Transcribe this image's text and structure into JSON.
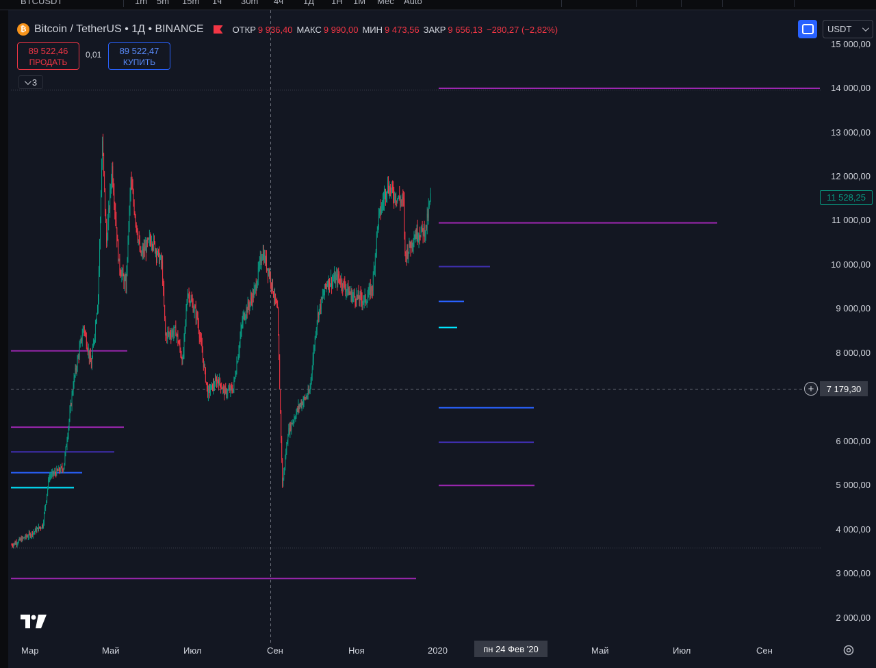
{
  "topbar": {
    "items": [
      "BTCUSDT",
      "1m",
      "5m",
      "15m",
      "1ч",
      "30m",
      "4ч",
      "1Д",
      "1Н",
      "1М",
      "Мес",
      "Auto"
    ]
  },
  "legend": {
    "coin_glyph": "₿",
    "symbol": "Bitcoin / TetherUS • 1Д • BINANCE",
    "open_label": "ОТКР",
    "open_value": "9 936,40",
    "high_label": "МАКС",
    "high_value": "9 990,00",
    "low_label": "МИН",
    "low_value": "9 473,56",
    "close_label": "ЗАКР",
    "close_value": "9 656,13",
    "change": "−280,27 (−2,82%)",
    "down_color": "#f23645",
    "up_color": "#089981"
  },
  "trade": {
    "sell_price": "89 522,46",
    "sell_label": "ПРОДАТЬ",
    "spread": "0,01",
    "buy_price": "89 522,47",
    "buy_label": "КУПИТЬ"
  },
  "indicators_collapse": {
    "count": "3"
  },
  "currency": {
    "selected": "USDT"
  },
  "price_axis": [
    "15 000,00",
    "14 000,00",
    "13 000,00",
    "12 000,00",
    "11 000,00",
    "10 000,00",
    "9 000,00",
    "8 000,00",
    "6 000,00",
    "5 000,00",
    "4 000,00",
    "3 000,00",
    "2 000,00"
  ],
  "last_price": "11 528,25",
  "crosshair": {
    "price": "7 179,30",
    "date": "пн 24 Фев '20"
  },
  "time_axis": [
    "Мар",
    "Май",
    "Июл",
    "Сен",
    "Ноя",
    "2020",
    "Май",
    "Июл",
    "Сен"
  ],
  "chart_data": {
    "type": "candlestick",
    "price_range": [
      1500,
      15100
    ],
    "period": "Feb 2019 – Oct 2020",
    "close_path": [
      [
        "2019-02-15",
        3650
      ],
      [
        "2019-03-15",
        3900
      ],
      [
        "2019-04-01",
        4100
      ],
      [
        "2019-04-10",
        5200
      ],
      [
        "2019-05-01",
        5400
      ],
      [
        "2019-05-15",
        7300
      ],
      [
        "2019-05-30",
        8600
      ],
      [
        "2019-06-10",
        7700
      ],
      [
        "2019-06-20",
        9300
      ],
      [
        "2019-06-26",
        12800
      ],
      [
        "2019-07-02",
        10500
      ],
      [
        "2019-07-10",
        12200
      ],
      [
        "2019-07-20",
        10000
      ],
      [
        "2019-07-30",
        9500
      ],
      [
        "2019-08-06",
        11900
      ],
      [
        "2019-08-20",
        10200
      ],
      [
        "2019-09-05",
        10600
      ],
      [
        "2019-09-20",
        10000
      ],
      [
        "2019-09-25",
        8400
      ],
      [
        "2019-10-10",
        8500
      ],
      [
        "2019-10-20",
        7800
      ],
      [
        "2019-10-27",
        9400
      ],
      [
        "2019-11-10",
        8800
      ],
      [
        "2019-11-25",
        7100
      ],
      [
        "2019-12-10",
        7400
      ],
      [
        "2019-12-20",
        7100
      ],
      [
        "2020-01-01",
        7200
      ],
      [
        "2020-01-15",
        8800
      ],
      [
        "2020-02-01",
        9400
      ],
      [
        "2020-02-12",
        10300
      ],
      [
        "2020-02-24",
        9700
      ],
      [
        "2020-03-05",
        8900
      ],
      [
        "2020-03-12",
        5000
      ],
      [
        "2020-03-20",
        6200
      ],
      [
        "2020-04-05",
        6800
      ],
      [
        "2020-04-20",
        7100
      ],
      [
        "2020-05-01",
        8800
      ],
      [
        "2020-05-15",
        9600
      ],
      [
        "2020-06-01",
        9700
      ],
      [
        "2020-06-20",
        9300
      ],
      [
        "2020-07-10",
        9200
      ],
      [
        "2020-07-20",
        9500
      ],
      [
        "2020-07-28",
        11000
      ],
      [
        "2020-08-10",
        11800
      ],
      [
        "2020-08-20",
        11600
      ],
      [
        "2020-09-03",
        11400
      ],
      [
        "2020-09-05",
        10200
      ],
      [
        "2020-09-20",
        10700
      ],
      [
        "2020-10-05",
        10800
      ],
      [
        "2020-10-12",
        11528
      ]
    ],
    "horizontal_levels": [
      {
        "price": 14000,
        "color": "#9c27b0"
      },
      {
        "price": 10950,
        "color": "#9c27b0"
      },
      {
        "price": 9960,
        "color": "#3f2fb0"
      },
      {
        "price": 9170,
        "color": "#2962ff"
      },
      {
        "price": 8580,
        "color": "#00e5ff"
      },
      {
        "price": 8050,
        "color": "#9c27b0"
      },
      {
        "price": 6760,
        "color": "#2962ff"
      },
      {
        "price": 6320,
        "color": "#9c27b0"
      },
      {
        "price": 5980,
        "color": "#3f2fb0"
      },
      {
        "price": 5760,
        "color": "#3f2fb0"
      },
      {
        "price": 5290,
        "color": "#2962ff"
      },
      {
        "price": 4950,
        "color": "#00e5ff"
      },
      {
        "price": 5000,
        "color": "#9c27b0"
      },
      {
        "price": 2890,
        "color": "#9c27b0"
      }
    ],
    "range_marks": [
      13960,
      3580
    ]
  }
}
